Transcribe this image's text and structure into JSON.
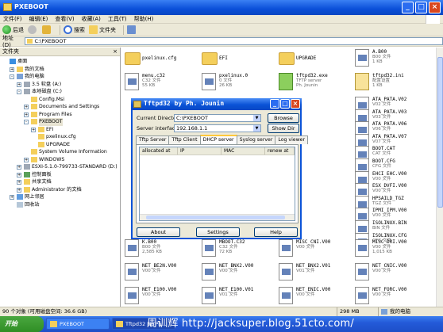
{
  "explorer": {
    "title": "PXEBOOT",
    "menu": [
      "文件(F)",
      "编辑(E)",
      "查看(V)",
      "收藏(A)",
      "工具(T)",
      "帮助(H)"
    ],
    "toolbar": {
      "back": "后退",
      "search": "搜索",
      "folders": "文件夹"
    },
    "address_label": "地址(D)",
    "address_value": "C:\\PXEBOOT",
    "folders_pane_title": "文件夹"
  },
  "tree": [
    {
      "label": "桌面",
      "icon": "desktop-icon",
      "indent": 0,
      "exp": ""
    },
    {
      "label": "我的文档",
      "icon": "documents-icon",
      "indent": 1,
      "exp": "+"
    },
    {
      "label": "我的电脑",
      "icon": "computer-icon",
      "indent": 1,
      "exp": "-"
    },
    {
      "label": "3.5 软盘 (A:)",
      "icon": "floppy-icon",
      "indent": 2,
      "exp": "+"
    },
    {
      "label": "本地磁盘 (C:)",
      "icon": "drive-icon",
      "indent": 2,
      "exp": "-"
    },
    {
      "label": "Config.Msi",
      "icon": "folder-icon",
      "indent": 3,
      "exp": ""
    },
    {
      "label": "Documents and Settings",
      "icon": "folder-icon",
      "indent": 3,
      "exp": "+"
    },
    {
      "label": "Program Files",
      "icon": "folder-icon",
      "indent": 3,
      "exp": "+"
    },
    {
      "label": "PXEBOOT",
      "icon": "folder-icon",
      "indent": 3,
      "exp": "-",
      "selected": true
    },
    {
      "label": "EFI",
      "icon": "folder-icon",
      "indent": 4,
      "exp": "+"
    },
    {
      "label": "pxelinux.cfg",
      "icon": "folder-icon",
      "indent": 4,
      "exp": ""
    },
    {
      "label": "UPGRADE",
      "icon": "folder-icon",
      "indent": 4,
      "exp": ""
    },
    {
      "label": "System Volume Information",
      "icon": "folder-icon",
      "indent": 3,
      "exp": ""
    },
    {
      "label": "WINDOWS",
      "icon": "folder-icon",
      "indent": 3,
      "exp": "+"
    },
    {
      "label": "ESXI-5.1.0-799733-STANDARD (D:)",
      "icon": "cdrom-icon",
      "indent": 2,
      "exp": "+"
    },
    {
      "label": "控制面板",
      "icon": "control-panel-icon",
      "indent": 2,
      "exp": "+"
    },
    {
      "label": "共享文档",
      "icon": "shared-folder-icon",
      "indent": 2,
      "exp": "+"
    },
    {
      "label": "Administrator 的文档",
      "icon": "documents-icon",
      "indent": 2,
      "exp": "+"
    },
    {
      "label": "网上邻居",
      "icon": "network-icon",
      "indent": 1,
      "exp": "+"
    },
    {
      "label": "回收站",
      "icon": "recycle-bin-icon",
      "indent": 1,
      "exp": ""
    }
  ],
  "files": [
    {
      "name": "pxelinux.cfg",
      "type": "folder",
      "col": 0,
      "row": 0
    },
    {
      "name": "EFI",
      "type": "folder",
      "col": 1,
      "row": 0
    },
    {
      "name": "UPGRADE",
      "type": "folder",
      "col": 2,
      "row": 0
    },
    {
      "name": "A.B00",
      "desc": "B00 文件",
      "size": "1 KB",
      "type": "sys",
      "col": 3,
      "row": 0
    },
    {
      "name": "menu.c32",
      "desc": "C32 文件",
      "size": "55 KB",
      "type": "sys",
      "col": 0,
      "row": 1
    },
    {
      "name": "pxelinux.0",
      "desc": "0 文件",
      "size": "26 KB",
      "type": "sys",
      "col": 1,
      "row": 1
    },
    {
      "name": "tftpd32.exe",
      "desc": "TFTP server",
      "size": "Ph. Jounin",
      "type": "exe",
      "col": 2,
      "row": 1
    },
    {
      "name": "tftpd32.ini",
      "desc": "配置设置",
      "size": "1 KB",
      "type": "ini",
      "col": 3,
      "row": 1
    },
    {
      "name": "ATA_PATA.V02",
      "desc": "V02 文件",
      "size": "",
      "type": "sys",
      "col": 3,
      "row": 2
    },
    {
      "name": "ATA_PATA.V03",
      "desc": "V03 文件",
      "size": "",
      "type": "sys",
      "col": 3,
      "row": 2
    },
    {
      "name": "ATA_PATA.V06",
      "desc": "V06 文件",
      "size": "",
      "type": "sys",
      "col": 3,
      "row": 3
    },
    {
      "name": "ATA_PATA.V07",
      "desc": "V07 文件",
      "size": "",
      "type": "sys",
      "col": 3,
      "row": 3
    },
    {
      "name": "BOOT.CAT",
      "desc": "CAT 文件",
      "size": "",
      "type": "sys",
      "col": 3,
      "row": 4
    },
    {
      "name": "BOOT.CFG",
      "desc": "CFG 文件",
      "size": "",
      "type": "sys",
      "col": 3,
      "row": 4
    },
    {
      "name": "EHCI_EHC.V00",
      "desc": "V00 文件",
      "size": "",
      "type": "sys",
      "col": 3,
      "row": 5
    },
    {
      "name": "ESX_DVFI.V00",
      "desc": "V00 文件",
      "size": "",
      "type": "sys",
      "col": 3,
      "row": 5
    },
    {
      "name": "HPSAILD_TGZ",
      "desc": "TGZ 文件",
      "size": "",
      "type": "sys",
      "col": 3,
      "row": 6
    },
    {
      "name": "IPMI_IPM.V00",
      "desc": "V00 文件",
      "size": "",
      "type": "sys",
      "col": 3,
      "row": 6
    },
    {
      "name": "ISOLINUX.BIN",
      "desc": "BIN 文件",
      "size": "",
      "type": "sys",
      "col": 3,
      "row": 7
    },
    {
      "name": "ISOLINUX.CFG",
      "desc": "CFG 文件",
      "size": "",
      "type": "sys",
      "col": 3,
      "row": 7
    },
    {
      "name": "K.B00",
      "desc": "B00 文件",
      "size": "2,585 KB",
      "type": "sys",
      "col": 0,
      "row": 8
    },
    {
      "name": "MBOOT.C32",
      "desc": "C32 文件",
      "size": "72 KB",
      "type": "sys",
      "col": 1,
      "row": 8
    },
    {
      "name": "MISC_CNI.V00",
      "desc": "V00 文件",
      "size": "",
      "type": "sys",
      "col": 2,
      "row": 8
    },
    {
      "name": "MISC_DRI.V00",
      "desc": "V00 文件",
      "size": "1,015 KB",
      "type": "sys",
      "col": 3,
      "row": 8
    },
    {
      "name": "NET_BE2N.V00",
      "desc": "V00 文件",
      "size": "",
      "type": "sys",
      "col": 0,
      "row": 9
    },
    {
      "name": "NET_BNX2.V00",
      "desc": "V00 文件",
      "size": "",
      "type": "sys",
      "col": 1,
      "row": 9
    },
    {
      "name": "NET_BNX2.V01",
      "desc": "V01 文件",
      "size": "",
      "type": "sys",
      "col": 2,
      "row": 9
    },
    {
      "name": "NET_CNIC.V00",
      "desc": "V00 文件",
      "size": "",
      "type": "sys",
      "col": 3,
      "row": 9
    },
    {
      "name": "NET_E100.V00",
      "desc": "V00 文件",
      "size": "",
      "type": "sys",
      "col": 0,
      "row": 10
    },
    {
      "name": "NET_E100.V01",
      "desc": "V01 文件",
      "size": "",
      "type": "sys",
      "col": 1,
      "row": 10
    },
    {
      "name": "NET_ENIC.V00",
      "desc": "V00 文件",
      "size": "",
      "type": "sys",
      "col": 2,
      "row": 10
    },
    {
      "name": "NET_FORC.V00",
      "desc": "V00 文件",
      "size": "",
      "type": "sys",
      "col": 3,
      "row": 10
    }
  ],
  "status": {
    "left": "90 个对象 (可用磁盘空间: 36.6 GB)",
    "size": "298 MB",
    "location": "我的电脑"
  },
  "taskbar": {
    "start": "开始",
    "items": [
      "PXEBOOT",
      "Tftpd32 by Ph..."
    ],
    "watermark": "周训辉 http://jacksuper.blog.51cto.com/"
  },
  "tftpd": {
    "title": "Tftpd32 by Ph. Jounin",
    "current_dir_label": "Current Directory",
    "current_dir": "C:\\PXEBOOT",
    "browse": "Browse",
    "server_if_label": "Server interfaces",
    "server_if": "192.168.1.1",
    "show_dir": "Show Dir",
    "tabs": [
      "Tftp Server",
      "Tftp Client",
      "DHCP server",
      "Syslog server",
      "Log viewer"
    ],
    "active_tab": 2,
    "columns": [
      "allocated at",
      "IP",
      "MAC",
      "renew at"
    ],
    "about": "About",
    "settings": "Settings",
    "help": "Help"
  }
}
